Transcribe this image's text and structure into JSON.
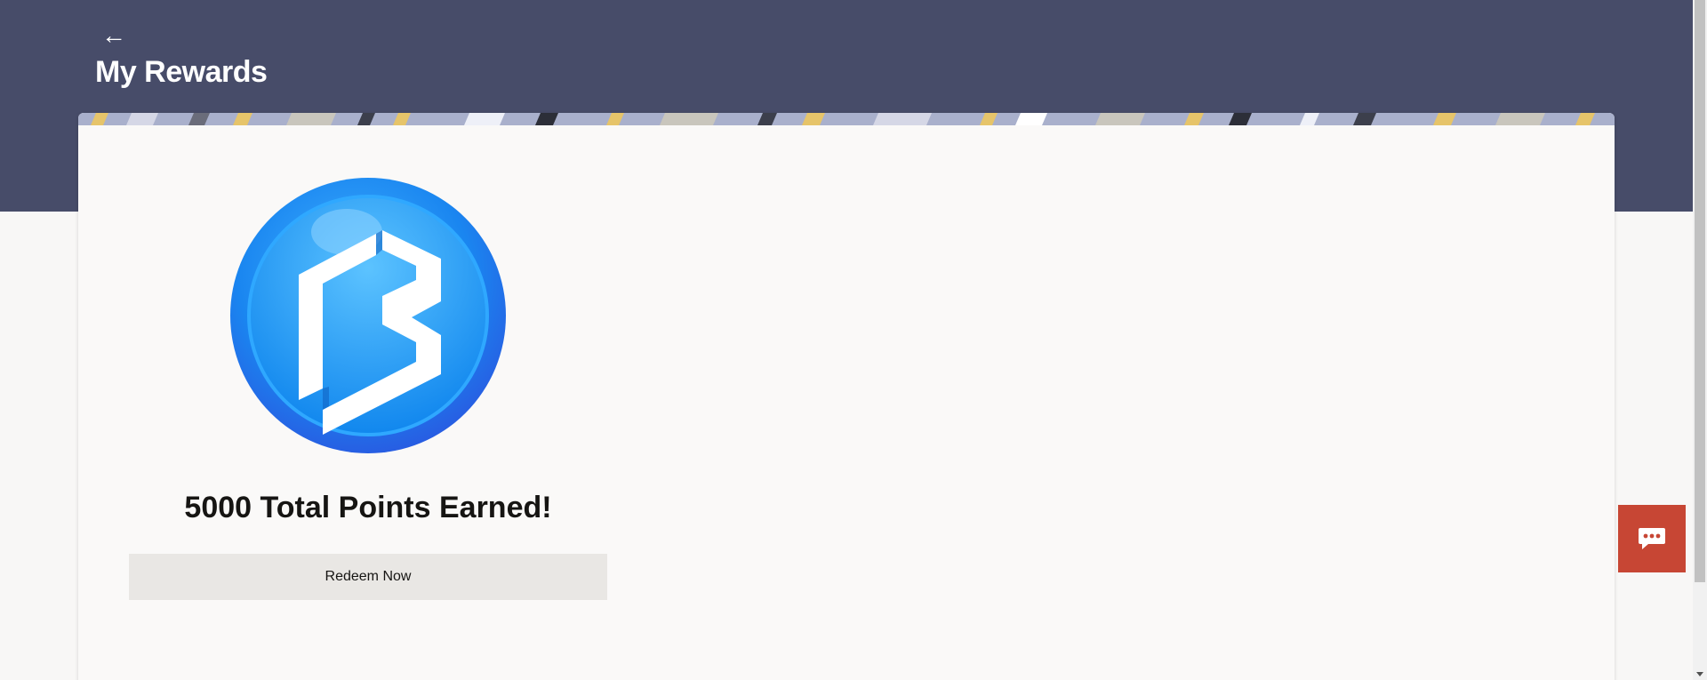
{
  "header": {
    "back_icon": "arrow-left-icon",
    "title": "My Rewards",
    "background_color": "#474c69"
  },
  "rewards": {
    "logo_icon": "bank-logo-icon",
    "points_text": "5000 Total Points Earned!",
    "redeem_label": "Redeem Now"
  },
  "chat": {
    "icon": "chat-bubble-icon",
    "color": "#c74634"
  }
}
